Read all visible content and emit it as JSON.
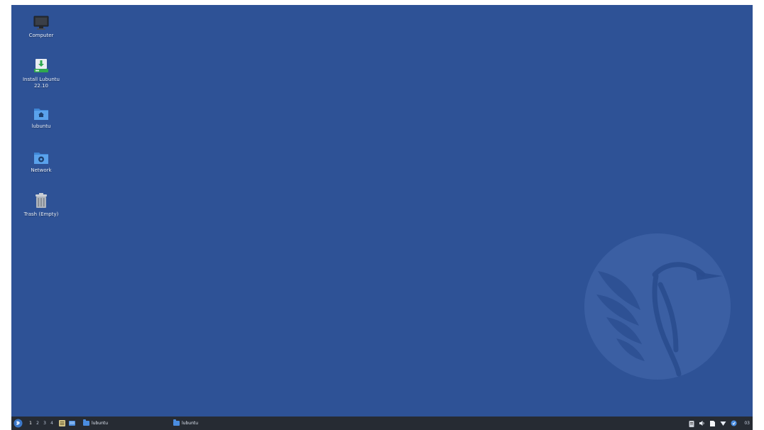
{
  "desktop": {
    "icons": [
      {
        "label": "Computer"
      },
      {
        "label": "Install Lubuntu 22.10"
      },
      {
        "label": "lubuntu"
      },
      {
        "label": "Network"
      },
      {
        "label": "Trash (Empty)"
      }
    ],
    "background_color": "#2e5296"
  },
  "taskbar": {
    "workspaces": [
      "1",
      "2",
      "3",
      "4"
    ],
    "active_workspace": "1",
    "tasks": [
      {
        "label": "lubuntu"
      },
      {
        "label": "lubuntu"
      }
    ],
    "clock": "03"
  }
}
